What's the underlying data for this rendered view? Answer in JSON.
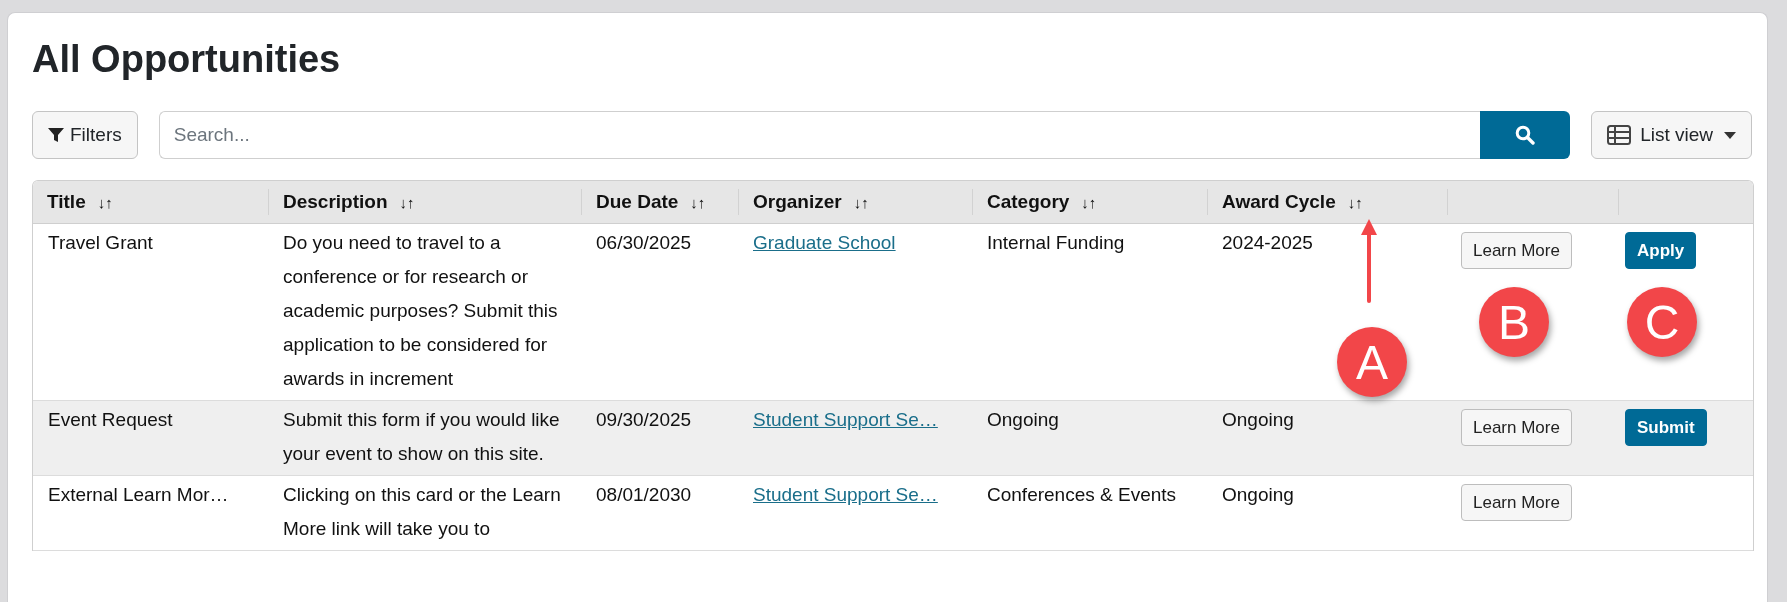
{
  "page": {
    "title": "All Opportunities"
  },
  "toolbar": {
    "filters_button": "Filters",
    "search": {
      "placeholder": "Search..."
    },
    "view_button": "List view"
  },
  "table": {
    "columns": [
      {
        "label": "Title",
        "sort": "↓↑"
      },
      {
        "label": "Description",
        "sort": "↓↑"
      },
      {
        "label": "Due Date",
        "sort": "↓↑"
      },
      {
        "label": "Organizer",
        "sort": "↓↑"
      },
      {
        "label": "Category",
        "sort": "↓↑"
      },
      {
        "label": "Award Cycle",
        "sort": "↓↑"
      }
    ],
    "rows": [
      {
        "title": "Travel Grant",
        "description": "Do you need to travel to a conference or for research or academic purposes? Submit this application to be considered for awards in increment",
        "due_date": "06/30/2025",
        "organizer": "Graduate School",
        "category": "Internal Funding",
        "award_cycle": "2024-2025",
        "actions": [
          {
            "label": "Learn More",
            "kind": "secondary"
          },
          {
            "label": "Apply",
            "kind": "primary"
          }
        ]
      },
      {
        "title": "Event Request",
        "description": "Submit this form if you would like your event to show on this site.",
        "due_date": "09/30/2025",
        "organizer": "Student Support Se…",
        "category": "Ongoing",
        "award_cycle": "Ongoing",
        "actions": [
          {
            "label": "Learn More",
            "kind": "secondary"
          },
          {
            "label": "Submit",
            "kind": "primary"
          }
        ]
      },
      {
        "title": "External Learn Mor…",
        "description": "Clicking on this card or the Learn More link will take you to",
        "due_date": "08/01/2030",
        "organizer": "Student Support Se…",
        "category": "Conferences & Events",
        "award_cycle": "Ongoing",
        "actions": [
          {
            "label": "Learn More",
            "kind": "secondary"
          }
        ]
      }
    ]
  },
  "annotations": [
    {
      "label": "A",
      "kind": "arrow"
    },
    {
      "label": "B"
    },
    {
      "label": "C"
    }
  ]
}
